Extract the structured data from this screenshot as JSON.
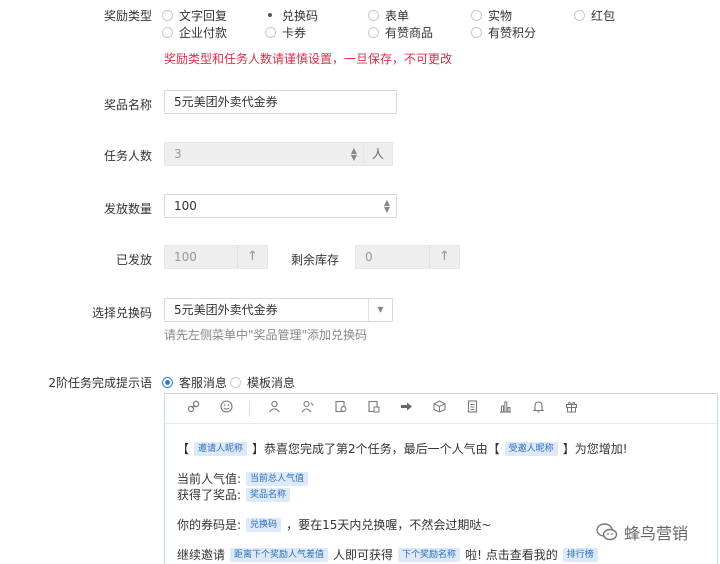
{
  "reward_type": {
    "label": "奖励类型",
    "options_row1": [
      "文字回复",
      "兑换码",
      "表单",
      "实物",
      "红包"
    ],
    "options_row2": [
      "企业付款",
      "卡券",
      "有赞商品",
      "有赞积分"
    ],
    "selected": "兑换码",
    "warning": "奖励类型和任务人数请谨慎设置，一旦保存，不可更改"
  },
  "prize_name": {
    "label": "奖品名称",
    "value": "5元美团外卖代金券"
  },
  "task_people": {
    "label": "任务人数",
    "value": "3",
    "unit": "人"
  },
  "issue_count": {
    "label": "发放数量",
    "value": "100"
  },
  "issued": {
    "label": "已发放",
    "value": "100"
  },
  "remaining": {
    "label": "剩余库存",
    "value": "0"
  },
  "select_code": {
    "label": "选择兑换码",
    "value": "5元美团外卖代金券",
    "hint": "请先左侧菜单中\"奖品管理\"添加兑换码"
  },
  "completion_tip": {
    "label": "2阶任务完成提示语",
    "options": [
      "客服消息",
      "模板消息"
    ],
    "selected": "客服消息"
  },
  "editor": {
    "line1": {
      "open": "【",
      "tag1": "邀请人昵称",
      "mid": "】恭喜您完成了第2个任务，最后一个人气由【",
      "tag2": "受邀人昵称",
      "end": "】为您增加!"
    },
    "line2": {
      "text": "当前人气值:",
      "tag": "当前总人气值"
    },
    "line3": {
      "text": "获得了奖品:",
      "tag": "奖品名称"
    },
    "line4": {
      "text": "你的券码是:",
      "tag": "兑换码",
      "end": "，要在15天内兑换喔，不然会过期哒~"
    },
    "line5": {
      "text": "继续邀请",
      "tag1": "距离下个奖励人气差值",
      "mid": "人即可获得",
      "tag2": "下个奖励名称",
      "mid2": "啦! 点击查看我的",
      "tag3": "排行榜"
    }
  },
  "watermark": {
    "text": "蜂鸟营销"
  }
}
